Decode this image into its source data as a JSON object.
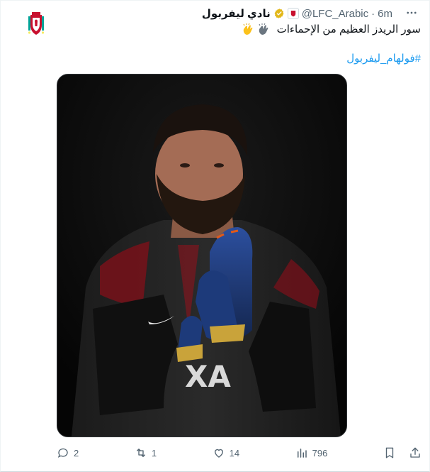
{
  "account": {
    "name": "نادي ليفربول",
    "handle": "@LFC_Arabic",
    "separator": "·",
    "time": "6m"
  },
  "tweet": {
    "text": "سور الريدز العظيم من الإحماءات",
    "hashtag": "#فولهام_ليفربول"
  },
  "actions": {
    "replies": "2",
    "retweets": "1",
    "likes": "14",
    "views": "796"
  },
  "colors": {
    "link": "#1d9bf0",
    "verified": "#e2b719",
    "muted": "#536471",
    "lfc_red": "#c8102e"
  },
  "icons": [
    "lfc-crest-icon",
    "verified-badge-icon",
    "affiliate-badge-icon",
    "more-icon",
    "clapping-hands-icon",
    "reply-icon",
    "retweet-icon",
    "like-icon",
    "views-icon",
    "bookmark-icon",
    "share-icon"
  ]
}
